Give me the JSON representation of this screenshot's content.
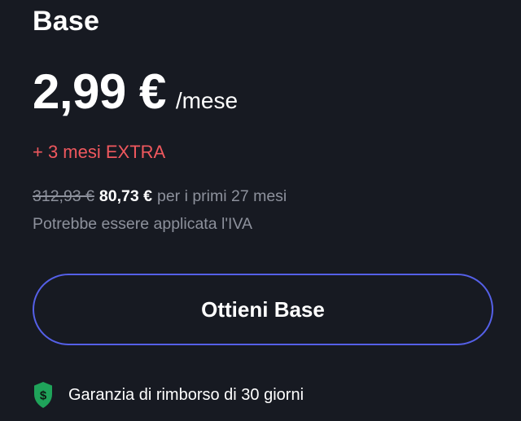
{
  "plan": {
    "name": "Base"
  },
  "price": {
    "amount": "2,99 €",
    "period": "/mese"
  },
  "promo": {
    "extra": "+ 3 mesi EXTRA"
  },
  "billing": {
    "old_price": "312,93 €",
    "new_price": "80,73 €",
    "period_text": "per i primi 27 mesi",
    "vat_note": "Potrebbe essere applicata l'IVA"
  },
  "cta": {
    "label": "Ottieni Base"
  },
  "guarantee": {
    "text": "Garanzia di rimborso di 30 giorni",
    "icon": "money-back-shield-icon"
  },
  "colors": {
    "background": "#171a22",
    "accent_border": "#5560e8",
    "promo_red": "#f0585e",
    "muted_text": "#8d919c",
    "shield_green": "#1fa35a"
  }
}
